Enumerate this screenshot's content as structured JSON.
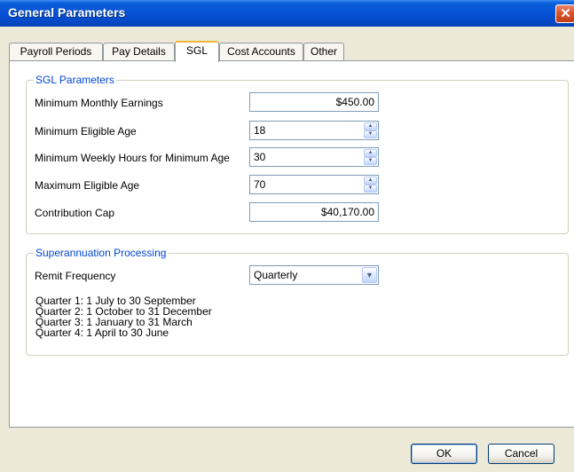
{
  "window": {
    "title": "General Parameters",
    "close_glyph": "✕",
    "close_icon": "close-icon"
  },
  "tabs": [
    {
      "label": "Payroll Periods",
      "active": false
    },
    {
      "label": "Pay Details",
      "active": false
    },
    {
      "label": "SGL",
      "active": true
    },
    {
      "label": "Cost Accounts",
      "active": false
    },
    {
      "label": "Other",
      "active": false
    }
  ],
  "sgl": {
    "legend": "SGL Parameters",
    "min_monthly": {
      "label": "Minimum Monthly Earnings",
      "value": "$450.00"
    },
    "min_age": {
      "label": "Minimum Eligible Age",
      "value": "18"
    },
    "min_hours": {
      "label": "Minimum Weekly Hours for Minimum Age",
      "value": "30"
    },
    "max_age": {
      "label": "Maximum Eligible Age",
      "value": "70"
    },
    "cap": {
      "label": "Contribution Cap",
      "value": "$40,170.00"
    }
  },
  "super": {
    "legend": "Superannuation Processing",
    "remit": {
      "label": "Remit Frequency",
      "value": "Quarterly"
    },
    "quarters": [
      "Quarter 1: 1 July to 30 September",
      "Quarter 2: 1 October to 31 December",
      "Quarter 3: 1 January to 31 March",
      "Quarter 4: 1 April to 30 June"
    ]
  },
  "buttons": {
    "ok": "OK",
    "cancel": "Cancel"
  },
  "glyphs": {
    "up": "▲",
    "down": "▼",
    "dropdown": "▼"
  }
}
